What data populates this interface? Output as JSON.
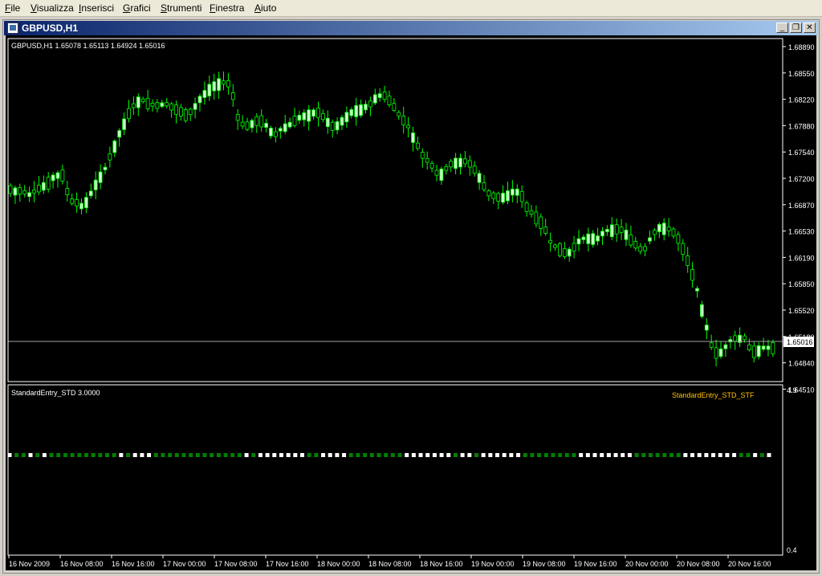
{
  "menu": [
    {
      "label": "File",
      "u": "F",
      "rest": "ile"
    },
    {
      "label": "Visualizza",
      "u": "V",
      "rest": "isualizza"
    },
    {
      "label": "Inserisci",
      "u": "I",
      "rest": "nserisci"
    },
    {
      "label": "Grafici",
      "u": "G",
      "rest": "rafici"
    },
    {
      "label": "Strumenti",
      "u": "S",
      "rest": "trumenti"
    },
    {
      "label": "Finestra",
      "u": "F",
      "rest": "inestra"
    },
    {
      "label": "Aiuto",
      "u": "A",
      "rest": "iuto"
    }
  ],
  "window": {
    "title": "GBPUSD,H1",
    "minimize_glyph": "_",
    "restore_glyph": "❐",
    "close_glyph": "✕"
  },
  "chart": {
    "info_label": "GBPUSD,H1  1.65078 1.65113 1.64924 1.65016",
    "current_price": "1.65016",
    "price_ticks": [
      "1.68890",
      "1.68550",
      "1.68220",
      "1.67880",
      "1.67540",
      "1.67200",
      "1.66870",
      "1.66530",
      "1.66190",
      "1.65850",
      "1.65520",
      "1.65180",
      "1.64840",
      "1.64510"
    ],
    "time_ticks": [
      "16 Nov 2009",
      "16 Nov 08:00",
      "16 Nov 16:00",
      "17 Nov 00:00",
      "17 Nov 08:00",
      "17 Nov 16:00",
      "18 Nov 00:00",
      "18 Nov 08:00",
      "18 Nov 16:00",
      "19 Nov 00:00",
      "19 Nov 08:00",
      "19 Nov 16:00",
      "20 Nov 00:00",
      "20 Nov 08:00",
      "20 Nov 16:00"
    ],
    "price_color": "#00ff00",
    "bull_color": "#ccffcc"
  },
  "indicator": {
    "label": "StandardEntry_STD 3.0000",
    "name": "StandardEntry_STD_STF",
    "name_color": "#ffc000",
    "scale_top": "4.9",
    "scale_bottom": "0.4",
    "dot_colors": {
      "white": "#ffffff",
      "green": "#008000"
    },
    "pattern": "WGGWGWGGGGGGGGGGWGWWWGGGGGGGGGGGGGWGWWWWWWWGGWWWWGGGGGGGGWWWWWWWGWWGWWWWWWGGGGGGGGWWWWWWWWGGGGGGGWWWWWWWWGGWGW"
  }
}
